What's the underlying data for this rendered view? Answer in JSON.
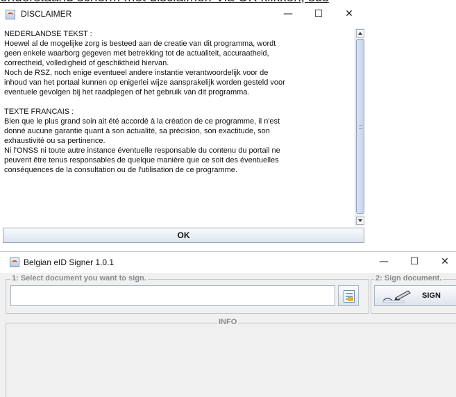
{
  "background_text": "onderstaand scherm met disclaimer. Via OK klikken, sus",
  "disclaimer": {
    "title": "DISCLAIMER",
    "controls": {
      "minimize": "—",
      "maximize": "☐",
      "close": "✕"
    },
    "lines": [
      "NEDERLANDSE TEKST :",
      "Hoewel al de mogelijke zorg is besteed aan de creatie van dit programma, wordt",
      "geen enkele waarborg gegeven met betrekking tot de actualiteit, accuraatheid,",
      "correctheid, volledigheid of geschiktheid hiervan.",
      "Noch de RSZ, noch enige eventueel andere instantie verantwoordelijk voor de",
      "inhoud van het portaal kunnen op enigerlei wijze aansprakelijk worden gesteld voor",
      "eventuele gevolgen bij het raadplegen of het gebruik van dit programma.",
      "",
      "TEXTE FRANCAIS :",
      "Bien que le plus grand soin ait été accordé à la création de ce programme, il n'est",
      "donné aucune garantie quant à son actualité, sa précision, son exactitude, son",
      "exhaustivité ou sa pertinence.",
      "Ni l'ONSS ni toute autre instance éventuelle responsable du contenu du portail ne",
      "peuvent être tenus responsables de quelque manière que ce soit des éventuelles",
      "conséquences de la consultation ou de l'utilisation de ce programme."
    ],
    "ok_label": "OK"
  },
  "signer": {
    "title": "Belgian eID Signer 1.0.1",
    "controls": {
      "minimize": "—",
      "maximize": "☐",
      "close": "✕"
    },
    "select_group_label": "1: Select document you want to sign.",
    "document_value": "",
    "sign_group_label": "2: Sign document.",
    "sign_label": "SIGN",
    "info_group_label": "INFO"
  },
  "icons": {
    "app_icon": "java-cup-icon",
    "browse_icon": "document-browse-icon",
    "sign_icon": "pen-signature-icon"
  }
}
